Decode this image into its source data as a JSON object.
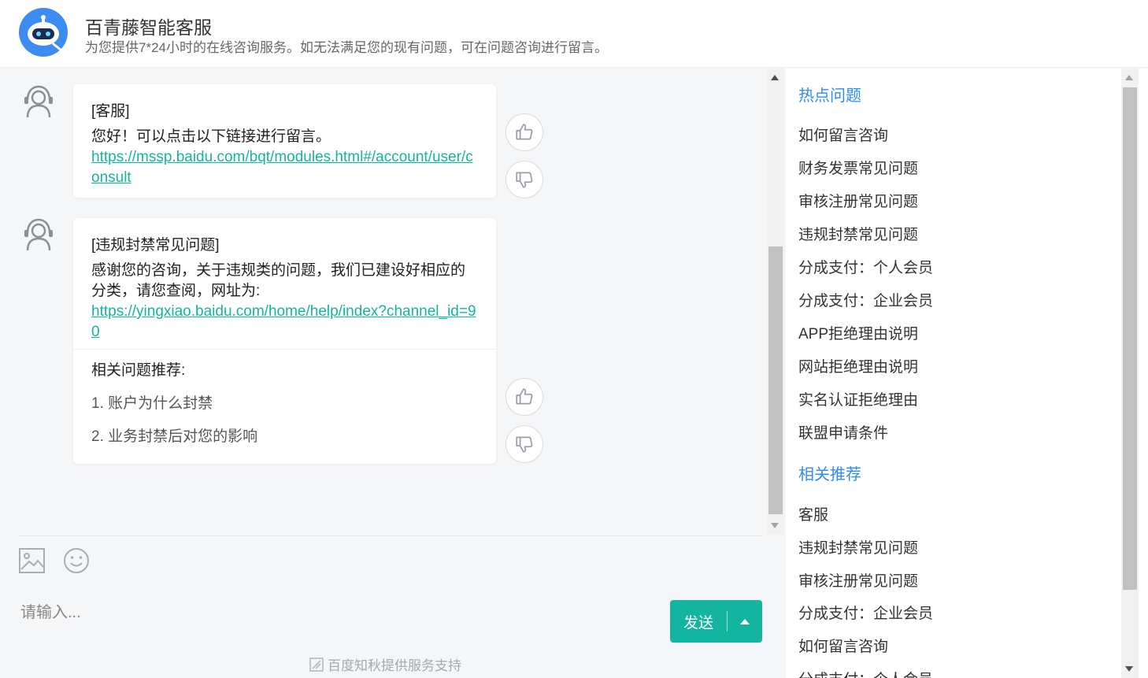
{
  "header": {
    "title": "百青藤智能客服",
    "subtitle": "为您提供7*24小时的在线咨询服务。如无法满足您的现有问题，可在问题咨询进行留言。"
  },
  "messages": [
    {
      "tag": "[客服]",
      "text": "您好！可以点击以下链接进行留言。",
      "link": "https://mssp.baidu.com/bqt/modules.html#/account/user/consult"
    },
    {
      "tag": "[违规封禁常见问题]",
      "text": "感谢您的咨询，关于违规类的问题，我们已建设好相应的分类，请您查阅，网址为:",
      "link": "https://yingxiao.baidu.com/home/help/index?channel_id=90",
      "recommend_title": "相关问题推荐:",
      "recommend": [
        "1. 账户为什么封禁",
        "2. 业务封禁后对您的影响"
      ]
    }
  ],
  "composer": {
    "placeholder": "请输入...",
    "send_label": "发送"
  },
  "footer": "百度知秋提供服务支持",
  "sidebar": {
    "hot_title": "热点问题",
    "hot": [
      "如何留言咨询",
      "财务发票常见问题",
      "审核注册常见问题",
      "违规封禁常见问题",
      "分成支付：个人会员",
      "分成支付：企业会员",
      "APP拒绝理由说明",
      "网站拒绝理由说明",
      "实名认证拒绝理由",
      "联盟申请条件"
    ],
    "related_title": "相关推荐",
    "related": [
      "客服",
      "违规封禁常见问题",
      "审核注册常见问题",
      "分成支付：企业会员",
      "如何留言咨询",
      "分成支付：个人会员"
    ]
  },
  "colors": {
    "accent": "#13b5a0",
    "link_blue": "#2e8ef0"
  }
}
